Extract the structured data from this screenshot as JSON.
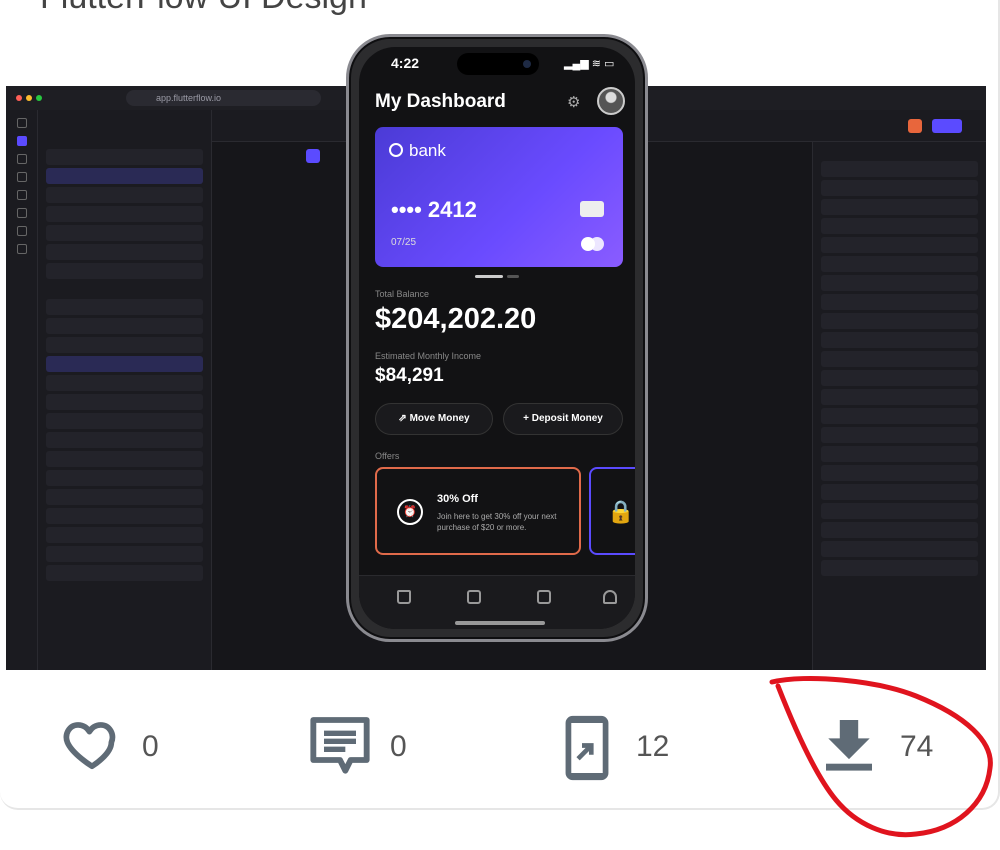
{
  "card": {
    "title": "FlutterFlow UI Design"
  },
  "screenshot": {
    "browser": {
      "url": "app.flutterflow.io"
    },
    "phone": {
      "status_time": "4:22",
      "status_icons": "▂▄▆ ≋ ▭",
      "dashboard_title": "My Dashboard",
      "bank_name": "bank",
      "card_number": "•••• 2412",
      "card_expiry": "07/25",
      "total_balance_label": "Total Balance",
      "total_balance": "$204,202.20",
      "income_label": "Estimated Monthly Income",
      "income": "$84,291",
      "move_money": "⇗  Move Money",
      "deposit_money": "+  Deposit Money",
      "offers_label": "Offers",
      "offer_title": "30% Off",
      "offer_desc": "Join here to get 30% off your next purchase of $20 or more."
    }
  },
  "stats": {
    "likes": "0",
    "comments": "0",
    "shares": "12",
    "downloads": "74"
  },
  "colors": {
    "accent": "#5b4bff",
    "offer_border": "#e06a4a",
    "annotation": "#e0141e",
    "icon_gray": "#5f6b76"
  }
}
